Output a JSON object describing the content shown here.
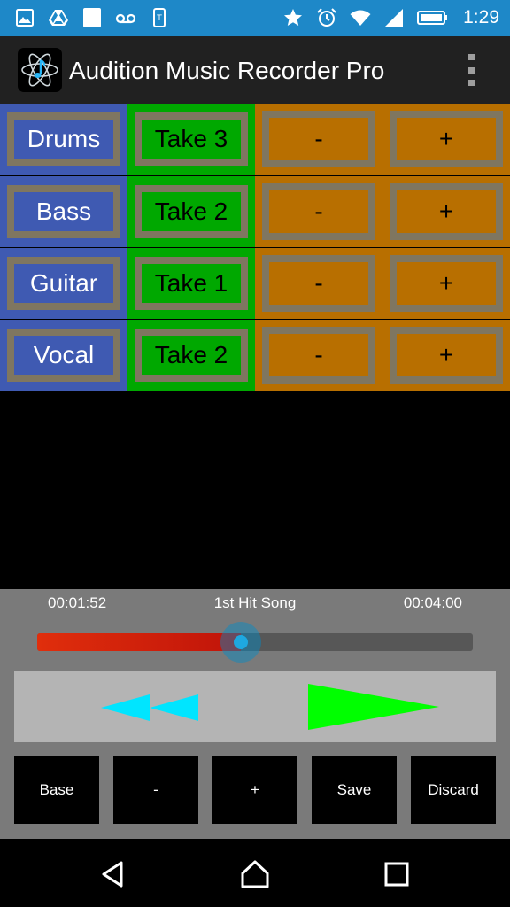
{
  "status_bar": {
    "time": "1:29",
    "icons_left": [
      "gallery-icon",
      "drive-icon",
      "white-square-icon",
      "voicemail-icon",
      "tmobile-icon"
    ],
    "icons_right": [
      "star-icon",
      "alarm-icon",
      "wifi-icon",
      "signal-icon",
      "battery-icon"
    ]
  },
  "app_bar": {
    "title": "Audition Music Recorder Pro",
    "logo_icon": "atom-music-icon",
    "menu_icon": "overflow-menu-icon"
  },
  "colors": {
    "status_bar": "#1e88c8",
    "app_bar": "#212121",
    "name_column": "#3f5ab2",
    "take_column": "#00a800",
    "control_column": "#b86f00",
    "button_border": "#7f7660",
    "player_panel": "#7a7a7a",
    "rewind": "#00e5ff",
    "play": "#00ff00",
    "seek_fill": "#e02e0c",
    "seek_thumb": "#1ea8e0"
  },
  "tracks": [
    {
      "name": "Drums",
      "take": "Take 3",
      "minus": "-",
      "plus": "+"
    },
    {
      "name": "Bass",
      "take": "Take 2",
      "minus": "-",
      "plus": "+"
    },
    {
      "name": "Guitar",
      "take": "Take 1",
      "minus": "-",
      "plus": "+"
    },
    {
      "name": "Vocal",
      "take": "Take 2",
      "minus": "-",
      "plus": "+"
    }
  ],
  "player": {
    "current_time": "00:01:52",
    "song_title": "1st Hit Song",
    "total_time": "00:04:00",
    "progress_fraction": 0.467,
    "rewind_icon": "rewind-icon",
    "play_icon": "play-icon"
  },
  "actions": {
    "base": "Base",
    "minus": "-",
    "plus": "+",
    "save": "Save",
    "discard": "Discard"
  },
  "nav_bar": {
    "back_icon": "back-icon",
    "home_icon": "home-icon",
    "recents_icon": "recents-icon"
  }
}
